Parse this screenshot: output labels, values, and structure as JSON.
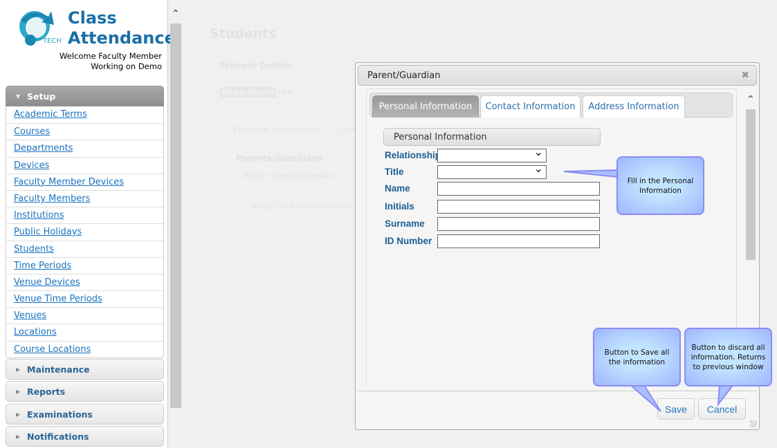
{
  "app": {
    "logo_text": "TECH",
    "title_line1": "Class",
    "title_line2": "Attendance",
    "welcome": "Welcome Faculty Member",
    "working_on": "Working on Demo"
  },
  "sidebar": {
    "setup_label": "Setup",
    "setup_items": [
      "Academic Terms",
      "Courses",
      "Departments",
      "Devices",
      "Faculty Member Devices",
      "Faculty Members",
      "Institutions",
      "Public Holidays",
      "Students",
      "Time Periods",
      "Venue Devices",
      "Venue Time Periods",
      "Venues",
      "Locations",
      "Course Locations"
    ],
    "sections": [
      "Maintenance",
      "Reports",
      "Examinations",
      "Notifications"
    ]
  },
  "background_page": {
    "title": "Students",
    "section": "Student Details",
    "department_label": "Department",
    "department_value": "Law",
    "tab1": "Personal Information",
    "tab2": "Con",
    "subsection": "Parents/Guardians",
    "assign_button": "Assign Parent/Guardian",
    "note": "Note: Click on the name of t"
  },
  "dialog": {
    "title": "Parent/Guardian",
    "tabs": [
      "Personal Information",
      "Contact Information",
      "Address Information"
    ],
    "active_tab": 0,
    "section_title": "Personal Information",
    "fields": [
      {
        "label": "Relationship",
        "type": "select",
        "value": ""
      },
      {
        "label": "Title",
        "type": "select",
        "value": ""
      },
      {
        "label": "Name",
        "type": "text",
        "value": ""
      },
      {
        "label": "Initials",
        "type": "text",
        "value": ""
      },
      {
        "label": "Surname",
        "type": "text",
        "value": ""
      },
      {
        "label": "ID Number",
        "type": "text",
        "value": ""
      }
    ],
    "save_label": "Save",
    "cancel_label": "Cancel"
  },
  "callouts": {
    "fill_info": "Fill in the Personal Information",
    "save_info": "Button to Save all the information",
    "cancel_info": "Button to discard all information. Returns to previous window"
  },
  "colors": {
    "accent": "#1a6fa8",
    "link": "#1a73c0",
    "callout_border": "#8a8cf5",
    "callout_fill": "#c2e4ff"
  }
}
